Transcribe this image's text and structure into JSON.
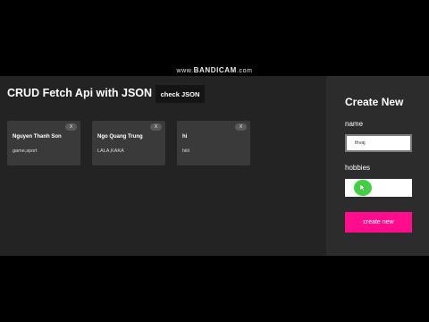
{
  "watermark": {
    "prefix": "www.",
    "brand": "BANDICAM",
    "suffix": ".com"
  },
  "main": {
    "title": "CRUD Fetch Api with JSON",
    "check_label": "check JSON",
    "cards": [
      {
        "name": "Nguyen Thanh Son",
        "hobbies": "game,sport",
        "close": "X"
      },
      {
        "name": "Ngo Quang Trung",
        "hobbies": "LALA,KAKA",
        "close": "X"
      },
      {
        "name": "hi",
        "hobbies": "hiiii",
        "close": "X"
      }
    ]
  },
  "form": {
    "title": "Create New",
    "name_label": "name",
    "name_value": "thvaj",
    "hobbies_label": "hobbies",
    "hobbies_value": "",
    "submit_label": "create new"
  },
  "colors": {
    "background": "#232323",
    "card": "#3a3a3a",
    "sidebar": "#2c2c2c",
    "accent": "#ff0d8c",
    "cursor": "#3fd13f"
  },
  "icons": {
    "cursor": "cursor-highlight-icon"
  }
}
